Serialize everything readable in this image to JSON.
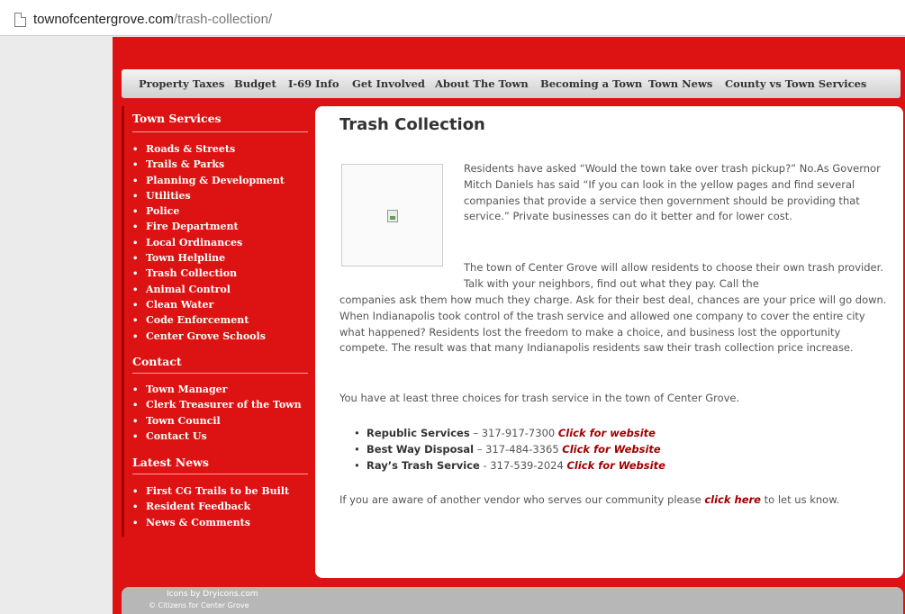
{
  "browser": {
    "url_domain": "townofcentergrove.com",
    "url_path": "/trash-collection/"
  },
  "nav": {
    "items": [
      "Property Taxes",
      "Budget",
      "I-69 Info",
      "Get Involved",
      "About The Town",
      "Becoming a Town",
      "Town News",
      "County vs Town Services"
    ]
  },
  "sidebar": {
    "services_heading": "Town Services",
    "services": [
      "Roads & Streets",
      "Trails & Parks",
      "Planning & Development",
      "Utilities",
      "Police",
      "Fire Department",
      "Local Ordinances",
      "Town Helpline",
      "Trash Collection",
      "Animal Control",
      "Clean Water",
      "Code Enforcement",
      "Center Grove Schools"
    ],
    "contact_heading": "Contact",
    "contact": [
      "Town Manager",
      "Clerk Treasurer of the Town",
      "Town Council",
      "Contact Us"
    ],
    "news_heading": "Latest News",
    "news": [
      "First CG Trails to be Built",
      "Resident Feedback",
      "News & Comments"
    ]
  },
  "content": {
    "title": "Trash Collection",
    "p1": "Residents have asked “Would the town take over trash pickup?” No.As Governor Mitch Daniels has said “If you can look in the yellow pages and find several companies that provide a service then government should be providing that service.” Private businesses can do it better and for lower cost.",
    "p2a": "The town of Center Grove will allow residents to choose their own trash provider. Talk with your neighbors, find out what they pay. Call the",
    "p2b": "companies ask them how much they charge. Ask for their best deal, chances are your price will go down. When Indianapolis took control of the trash service and allowed one company to cover the entire city what happened? Residents lost the freedom to make a choice, and business lost the opportunity compete. The result was that many Indianapolis residents saw their trash collection price increase.",
    "p3": "You have at least three choices for trash service in the town of Center Grove.",
    "vendors": [
      {
        "name": "Republic Services",
        "phone": " – 317-917-7300 ",
        "link": "Click for website"
      },
      {
        "name": "Best Way Disposal",
        "phone": " – 317-484-3365 ",
        "link": "Click for Website"
      },
      {
        "name": "Ray’s Trash Service",
        "phone": " -  317-539-2024 ",
        "link": "Click for Website"
      }
    ],
    "p4_before": "If you are aware of another vendor who serves our community please ",
    "p4_link": "click here",
    "p4_after": " to let us know."
  },
  "footer": {
    "credit": "Icons by Dryicons.com",
    "copyright": "© Citizens for Center Grove"
  },
  "colors": {
    "brand_red": "#dd1313",
    "link_red": "#a00000"
  }
}
